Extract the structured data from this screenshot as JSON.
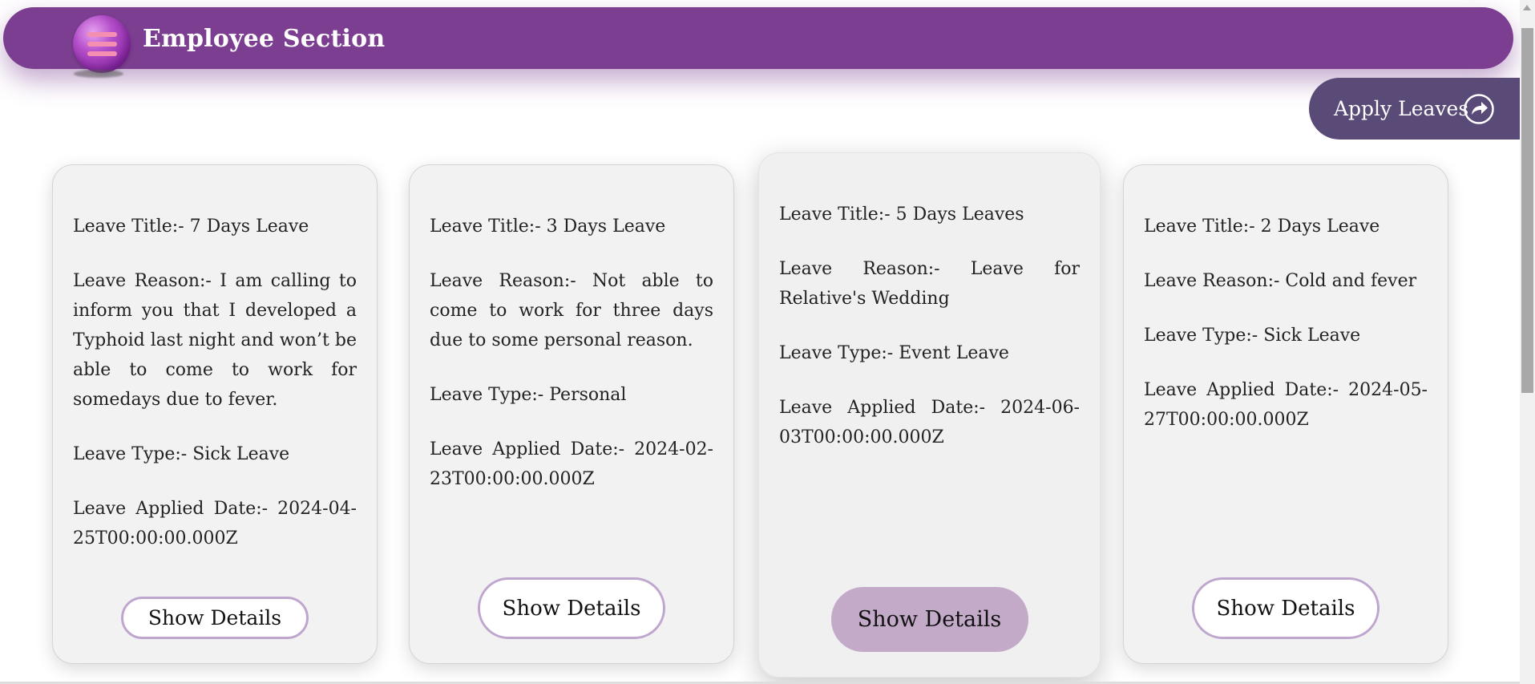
{
  "header": {
    "title": "Employee Section",
    "menu_icon": "hamburger-menu-icon",
    "background_color": "#7b3e90"
  },
  "actions": {
    "apply_leaves_label": "Apply Leaves",
    "apply_icon": "share-arrow-icon",
    "apply_color": "#5a4a78"
  },
  "leaves": [
    {
      "title": "Leave Title:- 7 Days Leave",
      "reason": "Leave Reason:- I am calling to inform you that I developed a Typhoid last night and won’t be able to come to work for somedays due to fever.",
      "type": "Leave Type:- Sick Leave",
      "applied_date": "Leave Applied Date:- 2024-04-25T00:00:00.000Z",
      "button_label": "Show Details"
    },
    {
      "title": "Leave Title:- 3 Days Leave",
      "reason": "Leave Reason:- Not able to come to work for three days due to some personal reason.",
      "type": "Leave Type:- Personal",
      "applied_date": "Leave Applied Date:- 2024-02-23T00:00:00.000Z",
      "button_label": "Show Details"
    },
    {
      "title": "Leave Title:- 5 Days Leaves",
      "reason": "Leave Reason:- Leave for Relative's Wedding",
      "type": "Leave Type:- Event Leave",
      "applied_date": "Leave Applied Date:- 2024-06-03T00:00:00.000Z",
      "button_label": "Show Details"
    },
    {
      "title": "Leave Title:- 2 Days Leave",
      "reason": "Leave Reason:- Cold and fever",
      "type": "Leave Type:- Sick Leave",
      "applied_date": "Leave Applied Date:- 2024-05-27T00:00:00.000Z",
      "button_label": "Show Details"
    }
  ],
  "colors": {
    "button_border": "#bfa6cf",
    "button_active_fill": "#c2aac8",
    "card_background": "#f2f2f2"
  }
}
